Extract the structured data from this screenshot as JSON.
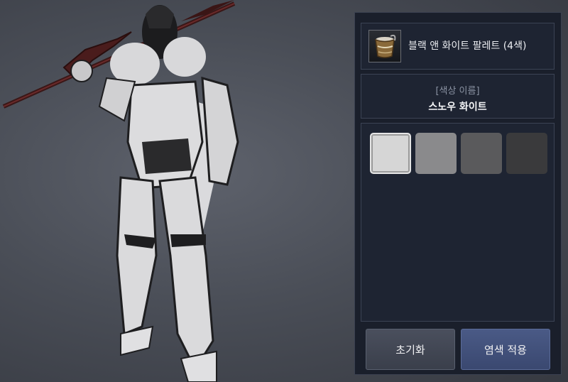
{
  "item": {
    "name": "블랙 앤 화이트 팔레트 (4색)",
    "icon": "dye-bucket-icon"
  },
  "color_name": {
    "label": "[색상 이름]",
    "value": "스노우 화이트"
  },
  "swatches": [
    {
      "color": "#d6d6d6",
      "selected": true
    },
    {
      "color": "#8a8a8c",
      "selected": false
    },
    {
      "color": "#5a5a5c",
      "selected": false
    },
    {
      "color": "#3a3a3c",
      "selected": false
    }
  ],
  "buttons": {
    "reset": "초기화",
    "apply": "염색 적용"
  }
}
